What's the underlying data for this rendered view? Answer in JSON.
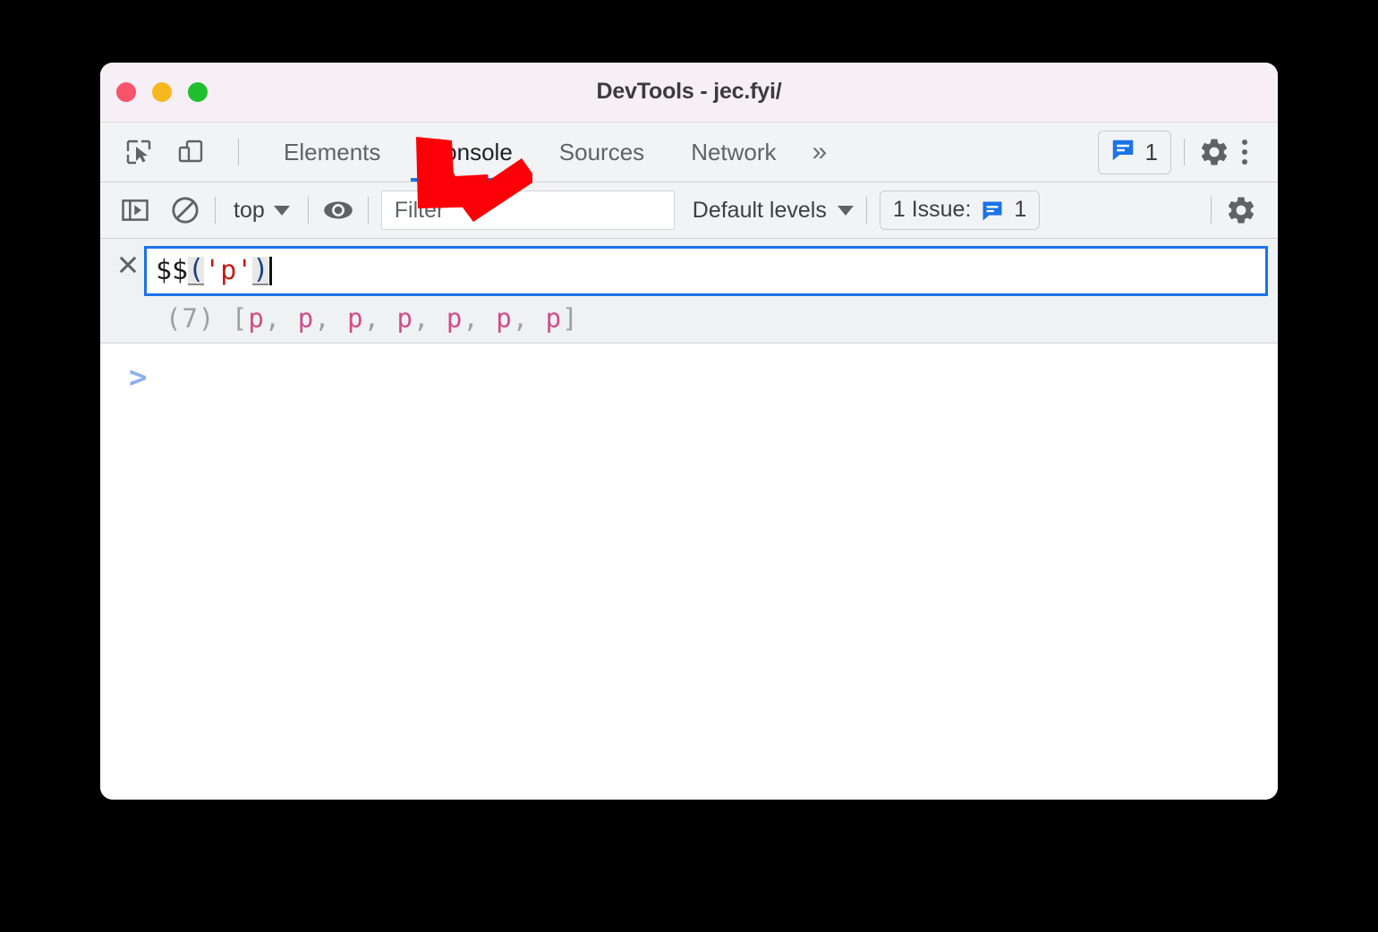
{
  "window": {
    "title": "DevTools - jec.fyi/",
    "traffic_lights": [
      {
        "name": "close",
        "color": "#f6546a"
      },
      {
        "name": "minimize",
        "color": "#f5b81f"
      },
      {
        "name": "maximize",
        "color": "#1ec02f"
      }
    ]
  },
  "tabbar": {
    "left_icons": [
      {
        "name": "inspect-element-icon",
        "label": "Inspect element"
      },
      {
        "name": "device-toolbar-icon",
        "label": "Toggle device toolbar"
      }
    ],
    "tabs": [
      {
        "label": "Elements",
        "active": false
      },
      {
        "label": "Console",
        "active": true
      },
      {
        "label": "Sources",
        "active": false
      },
      {
        "label": "Network",
        "active": false
      }
    ],
    "more_tabs_label": "»",
    "issues_count": "1",
    "settings_icon": "gear-icon",
    "menu_icon": "kebab-menu-icon"
  },
  "console_toolbar": {
    "sidebar_toggle_icon": "console-sidebar-icon",
    "clear_console_icon": "clear-console-icon",
    "context_value": "top",
    "live_expression_icon": "eye-icon",
    "filter_placeholder": "Filter",
    "filter_value": "",
    "levels_value": "Default levels",
    "issues_label": "1 Issue:",
    "issues_count": "1",
    "settings_icon": "gear-icon"
  },
  "console": {
    "close_icon": "close-icon",
    "input": {
      "function": "$$",
      "open_paren": "(",
      "string_arg": "'p'",
      "close_paren": ")",
      "full_text": "$$('p')"
    },
    "result": {
      "length_label": "(7)",
      "open_bracket": "[",
      "close_bracket": "]",
      "separator": ", ",
      "nodes": [
        "p",
        "p",
        "p",
        "p",
        "p",
        "p",
        "p"
      ]
    },
    "prompt_chevron": ">"
  },
  "annotation": {
    "arrow": {
      "name": "red-arrow-annotation",
      "color": "#fb0007",
      "points_to": "eye-icon"
    }
  },
  "colors": {
    "accent_blue": "#1a73e8",
    "titlebar": "#f7eff6",
    "toolbar": "#f1f3f4",
    "node_pink": "#d44b86",
    "string_red": "#c41a16",
    "arrow_red": "#fb0007"
  }
}
